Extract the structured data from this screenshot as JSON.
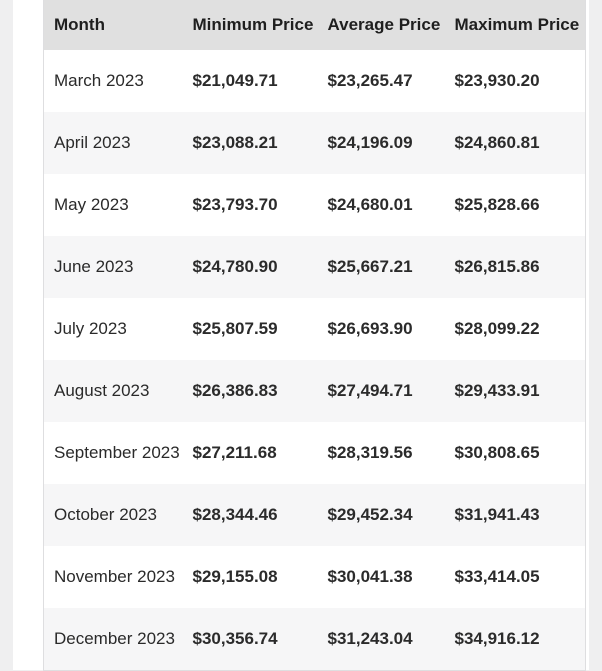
{
  "table": {
    "headers": [
      "Month",
      "Minimum Price",
      "Average Price",
      "Maximum Price"
    ],
    "rows": [
      {
        "month": "March 2023",
        "min": "$21,049.71",
        "avg": "$23,265.47",
        "max": "$23,930.20"
      },
      {
        "month": "April 2023",
        "min": "$23,088.21",
        "avg": "$24,196.09",
        "max": "$24,860.81"
      },
      {
        "month": "May 2023",
        "min": "$23,793.70",
        "avg": "$24,680.01",
        "max": "$25,828.66"
      },
      {
        "month": "June 2023",
        "min": "$24,780.90",
        "avg": "$25,667.21",
        "max": "$26,815.86"
      },
      {
        "month": "July 2023",
        "min": "$25,807.59",
        "avg": "$26,693.90",
        "max": "$28,099.22"
      },
      {
        "month": "August 2023",
        "min": "$26,386.83",
        "avg": "$27,494.71",
        "max": "$29,433.91"
      },
      {
        "month": "September 2023",
        "min": "$27,211.68",
        "avg": "$28,319.56",
        "max": "$30,808.65"
      },
      {
        "month": "October 2023",
        "min": "$28,344.46",
        "avg": "$29,452.34",
        "max": "$31,941.43"
      },
      {
        "month": "November 2023",
        "min": "$29,155.08",
        "avg": "$30,041.38",
        "max": "$33,414.05"
      },
      {
        "month": "December 2023",
        "min": "$30,356.74",
        "avg": "$31,243.04",
        "max": "$34,916.12"
      }
    ]
  }
}
